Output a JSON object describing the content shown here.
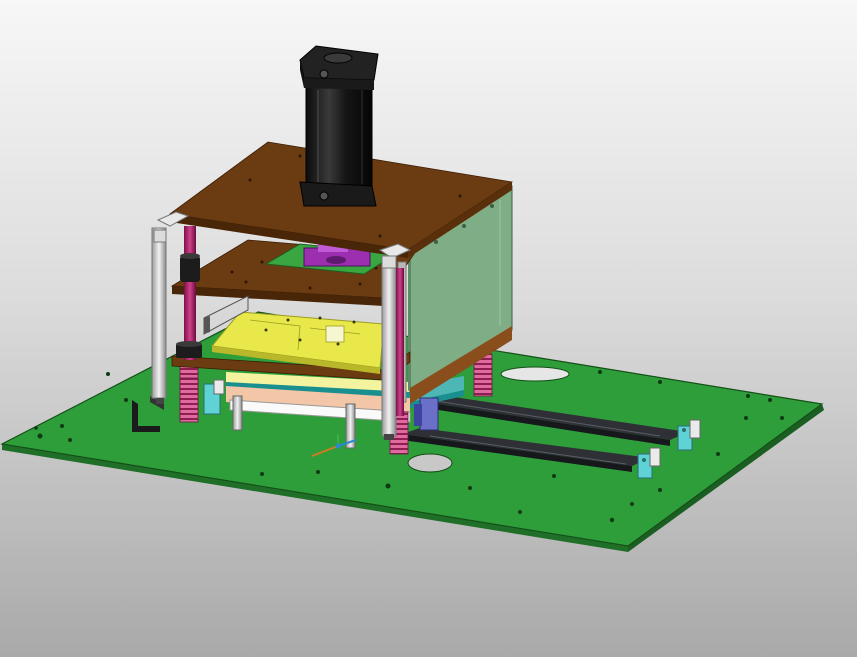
{
  "viewport": {
    "background_top": "#f7f7f7",
    "background_bottom": "#a9a9a9"
  },
  "colors": {
    "base_plate": "#2e9e3a",
    "base_plate_edge": "#1f6f28",
    "pcb_board": "#6b3b12",
    "pcb_board_edge": "#4a2608",
    "side_panel": "#7fae86",
    "cylinder": "#1b1b1b",
    "spring": "#c23a7a",
    "guide_rod": "#b2226e",
    "yellow_plate": "#e8e84a",
    "rail": "#2e3036",
    "clamp": "#5fd2d6",
    "bracket": "#d6d6d6",
    "purple_part": "#9b2fb0"
  },
  "parts": [
    "base-plate",
    "pneumatic-cylinder",
    "top-board",
    "middle-board",
    "lower-board",
    "yellow-test-plate",
    "side-panel",
    "corner-posts",
    "guide-rods",
    "compression-springs",
    "linear-rails",
    "toggle-clamps",
    "coordinate-triad"
  ]
}
